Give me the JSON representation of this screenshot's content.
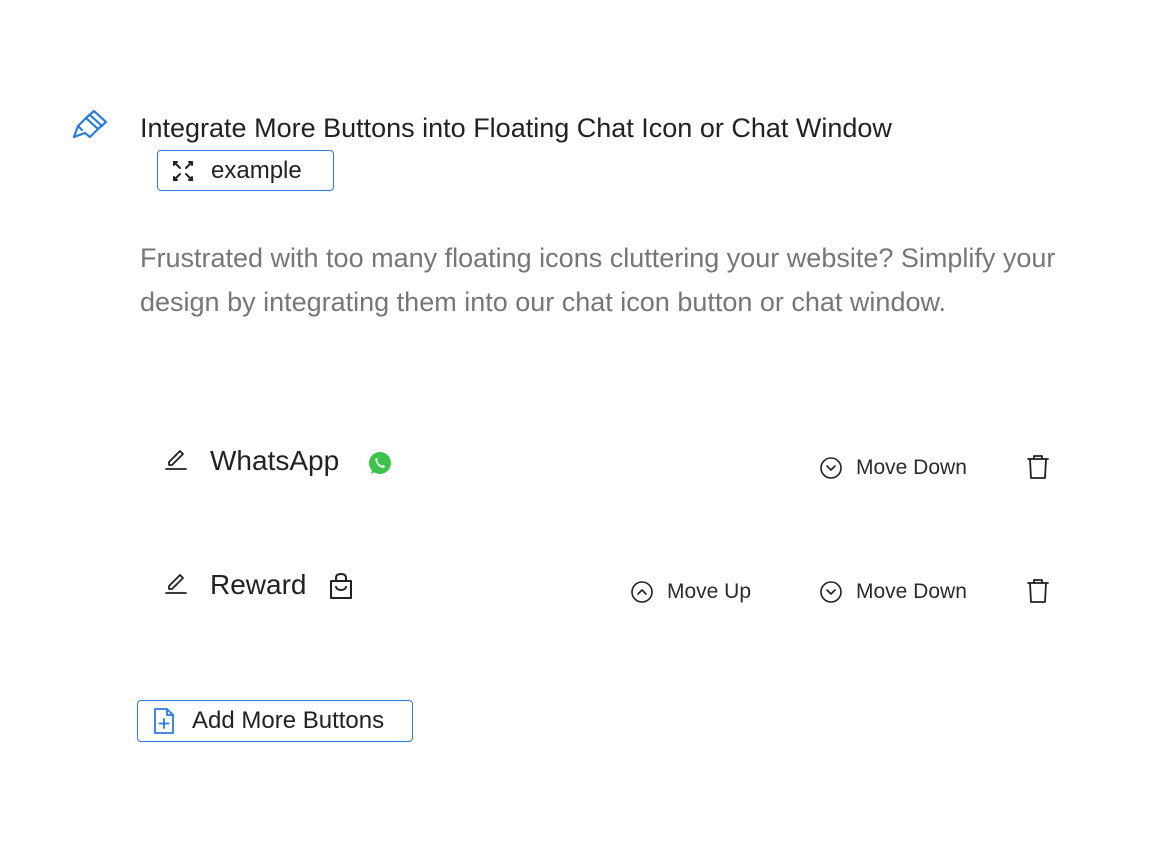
{
  "section": {
    "icon": "paintbrush-icon",
    "title": "Integrate More Buttons into Floating Chat Icon or Chat Window",
    "example_label": "example",
    "description": "Frustrated with too many floating icons cluttering your website? Simplify your design by integrating them into our chat icon button or chat window."
  },
  "buttons": [
    {
      "name": "WhatsApp",
      "icon": "whatsapp-icon",
      "move_down_label": "Move Down"
    },
    {
      "name": "Reward",
      "icon": "shopping-bag-icon",
      "move_up_label": "Move Up",
      "move_down_label": "Move Down"
    }
  ],
  "add_more_label": "Add More Buttons",
  "colors": {
    "accent": "#2a7ae2",
    "whatsapp": "#3cc34a",
    "text": "#222222",
    "muted": "#767676"
  }
}
